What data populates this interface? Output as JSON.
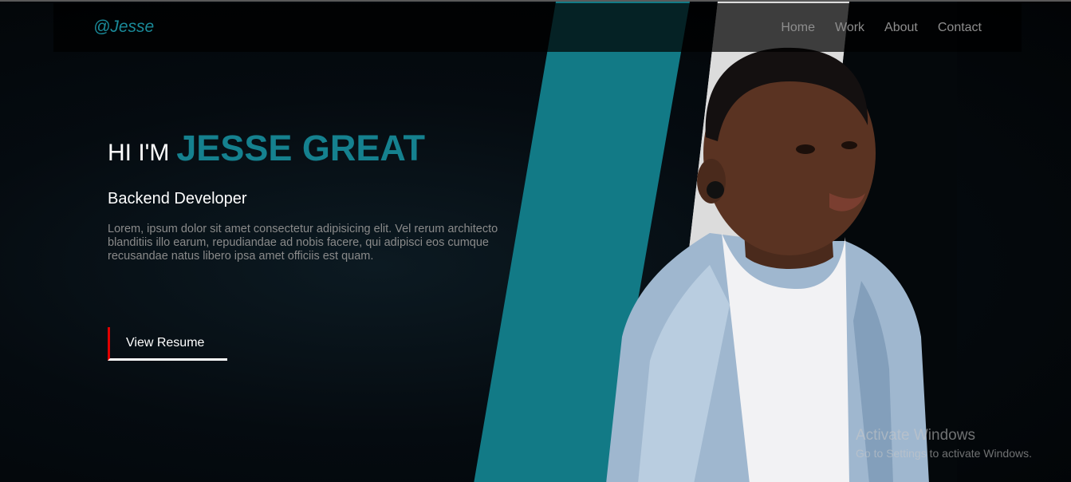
{
  "navbar": {
    "logo": "@Jesse",
    "links": [
      "Home",
      "Work",
      "About",
      "Contact"
    ]
  },
  "hero": {
    "greeting": "HI I'M",
    "name": "JESSE GREAT",
    "role": "Backend Developer",
    "bio": "Lorem, ipsum dolor sit amet consectetur adipisicing elit. Vel rerum architecto blanditiis illo earum, repudiandae ad nobis facere, qui adipisci eos cumque recusandae natus libero ipsa amet officiis est quam.",
    "button_label": "View Resume"
  },
  "watermark": {
    "title": "Activate Windows",
    "subtitle": "Go to Settings to activate Windows."
  },
  "colors": {
    "accent": "#15818f",
    "button_left_border": "#e00000",
    "background": "#050b10"
  }
}
